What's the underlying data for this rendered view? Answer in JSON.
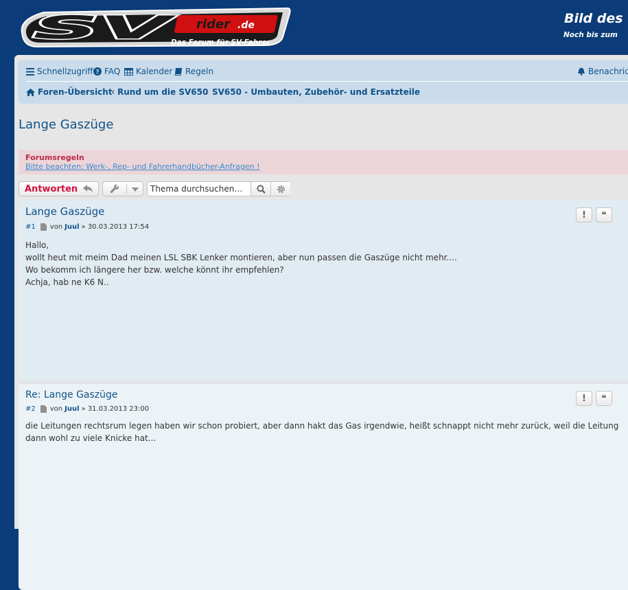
{
  "header": {
    "logo_text": "SV rider.de",
    "subtitle": "Das Forum für SV-Fahrer",
    "banner_title": "Bild des",
    "banner_subtitle": "Noch bis zum"
  },
  "nav": {
    "quick_access": "Schnellzugriff",
    "faq": "FAQ",
    "calendar": "Kalender",
    "rules": "Regeln",
    "notifications": "Benachrich"
  },
  "breadcrumbs": [
    {
      "label": "Foren-Übersicht"
    },
    {
      "label": "Rund um die SV650"
    },
    {
      "label": "SV650 - Umbauten, Zubehör- und Ersatzteile"
    }
  ],
  "topic": {
    "title": "Lange Gaszüge"
  },
  "forum_rules": {
    "title": "Forumsregeln",
    "link_text": "Bitte beachten: Werk-, Rep- und Fahrerhandbücher-Anfragen !"
  },
  "actions": {
    "reply_label": "Antworten",
    "search_placeholder": "Thema durchsuchen…"
  },
  "posts": [
    {
      "title": "Lange Gaszüge",
      "number": "#1",
      "by": "von",
      "author": "Juul",
      "date": "» 30.03.2013 17:54",
      "body": [
        "Hallo,",
        "wollt heut mit meim Dad meinen LSL SBK Lenker montieren, aber nun passen die Gaszüge nicht mehr....",
        "Wo bekomm ich längere her bzw. welche könnt ihr empfehlen?",
        "Achja, hab ne K6 N.."
      ]
    },
    {
      "title": "Re: Lange Gaszüge",
      "number": "#2",
      "by": "von",
      "author": "Juul",
      "date": "» 31.03.2013 23:00",
      "body": [
        "die Leitungen rechtsrum legen haben wir schon probiert, aber dann hakt das Gas irgendwie, heißt schnappt nicht mehr zurück, weil die Leitung",
        "dann wohl zu viele Knicke hat..."
      ]
    }
  ],
  "post_buttons": {
    "report": "!",
    "quote": "❝"
  },
  "colors": {
    "header_bg": "#0b3b78",
    "link": "#105289",
    "reply": "#d31141",
    "rules_bg": "#ecd5d8"
  }
}
